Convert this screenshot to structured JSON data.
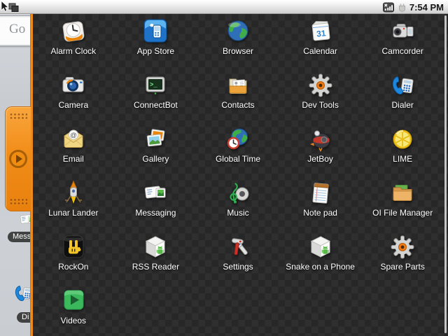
{
  "status_bar": {
    "time": "7:54 PM",
    "signal_icon": "no-signal",
    "battery_icon": "battery-charging"
  },
  "home_screen": {
    "google_widget_text": "Go",
    "messaging_shortcut_label": "Mess",
    "dialer_shortcut_label": "Di"
  },
  "app_drawer": {
    "apps": [
      {
        "label": "Alarm Clock",
        "icon": "alarm-clock"
      },
      {
        "label": "App Store",
        "icon": "app-store"
      },
      {
        "label": "Browser",
        "icon": "browser"
      },
      {
        "label": "Calendar",
        "icon": "calendar"
      },
      {
        "label": "Camcorder",
        "icon": "camcorder"
      },
      {
        "label": "Camera",
        "icon": "camera"
      },
      {
        "label": "ConnectBot",
        "icon": "connectbot"
      },
      {
        "label": "Contacts",
        "icon": "contacts"
      },
      {
        "label": "Dev Tools",
        "icon": "dev-tools"
      },
      {
        "label": "Dialer",
        "icon": "dialer"
      },
      {
        "label": "Email",
        "icon": "email"
      },
      {
        "label": "Gallery",
        "icon": "gallery"
      },
      {
        "label": "Global Time",
        "icon": "global-time"
      },
      {
        "label": "JetBoy",
        "icon": "jetboy"
      },
      {
        "label": "LIME",
        "icon": "lime"
      },
      {
        "label": "Lunar Lander",
        "icon": "lunar-lander"
      },
      {
        "label": "Messaging",
        "icon": "messaging"
      },
      {
        "label": "Music",
        "icon": "music"
      },
      {
        "label": "Note pad",
        "icon": "notepad"
      },
      {
        "label": "OI File Manager",
        "icon": "oi-file-manager"
      },
      {
        "label": "RockOn",
        "icon": "rockon"
      },
      {
        "label": "RSS Reader",
        "icon": "rss-reader"
      },
      {
        "label": "Settings",
        "icon": "settings"
      },
      {
        "label": "Snake on a Phone",
        "icon": "snake"
      },
      {
        "label": "Spare Parts",
        "icon": "spare-parts"
      },
      {
        "label": "Videos",
        "icon": "videos"
      }
    ]
  },
  "colors": {
    "drawer_background": "#282828",
    "handle_orange": "#f28d18",
    "label_text": "#ffffff",
    "status_bar": "#e8e8e8"
  }
}
